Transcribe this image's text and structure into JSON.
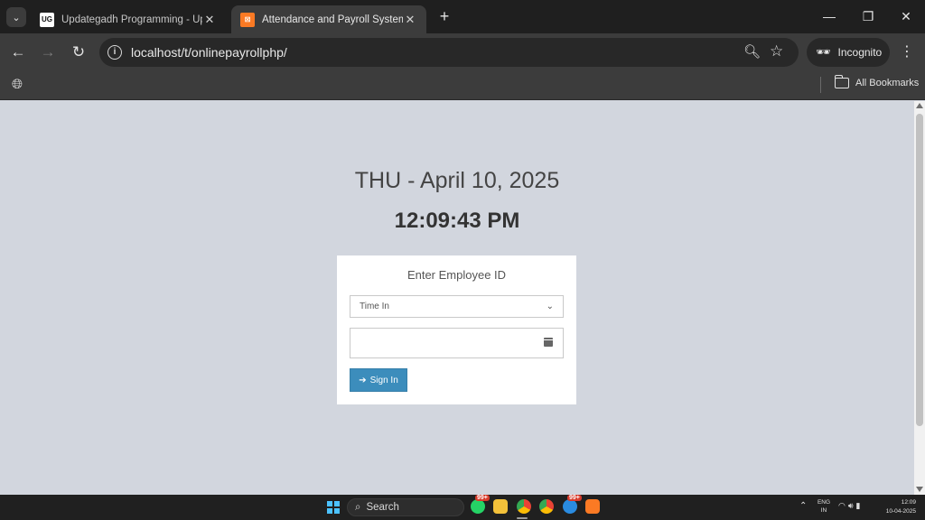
{
  "browser": {
    "tabs": [
      {
        "title": "Updategadh Programming - Upda",
        "favicon": "UG"
      },
      {
        "title": "Attendance and Payroll System",
        "favicon": "X"
      }
    ],
    "url": "localhost/t/onlinepayrollphp/",
    "incognito_label": "Incognito",
    "bookmarks_label": "All Bookmarks"
  },
  "page": {
    "date_text": "THU - April 10, 2025",
    "time_text": "12:09:43 PM",
    "login": {
      "title": "Enter Employee ID",
      "select_value": "Time In",
      "employee_id_value": "",
      "signin_label": "Sign In"
    }
  },
  "taskbar": {
    "search_label": "Search",
    "badge_1": "99+",
    "badge_2": "99+",
    "lang_top": "ENG",
    "lang_bottom": "IN",
    "clock_time": "12:09",
    "clock_date": "10-04-2025"
  },
  "colors": {
    "page_bg": "#d2d6de",
    "button_primary": "#3c8dbc",
    "chrome_dark": "#1f1f1f",
    "chrome_toolbar": "#3c3c3c"
  }
}
